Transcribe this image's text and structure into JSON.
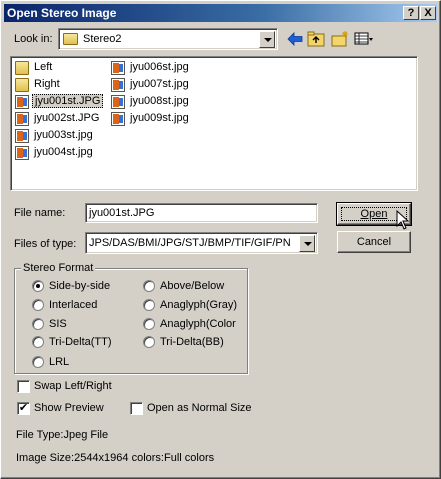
{
  "window": {
    "title": "Open Stereo Image"
  },
  "titlebar_buttons": {
    "help": "?",
    "close": "X"
  },
  "look_in": {
    "label": "Look in:",
    "value": "Stereo2"
  },
  "toolbar_icons": [
    "back-arrow-icon",
    "up-folder-icon",
    "new-folder-icon",
    "view-menu-icon"
  ],
  "files": [
    {
      "name": "Left",
      "type": "folder"
    },
    {
      "name": "Right",
      "type": "folder"
    },
    {
      "name": "jyu001st.JPG",
      "type": "jpg",
      "selected": true
    },
    {
      "name": "jyu002st.JPG",
      "type": "jpg"
    },
    {
      "name": "jyu003st.jpg",
      "type": "jpg"
    },
    {
      "name": "jyu004st.jpg",
      "type": "jpg"
    },
    {
      "name": "jyu006st.jpg",
      "type": "jpg"
    },
    {
      "name": "jyu007st.jpg",
      "type": "jpg"
    },
    {
      "name": "jyu008st.jpg",
      "type": "jpg"
    },
    {
      "name": "jyu009st.jpg",
      "type": "jpg"
    }
  ],
  "file_name": {
    "label": "File name:",
    "value": "jyu001st.JPG"
  },
  "file_type": {
    "label": "Files of type:",
    "value": "JPS/DAS/BMI/JPG/STJ/BMP/TIF/GIF/PN"
  },
  "buttons": {
    "open": "Open",
    "cancel": "Cancel"
  },
  "stereo_format": {
    "legend": "Stereo Format",
    "options": [
      {
        "label": "Side-by-side",
        "checked": true
      },
      {
        "label": "Interlaced"
      },
      {
        "label": "SIS"
      },
      {
        "label": "Tri-Delta(TT)"
      },
      {
        "label": "LRL"
      },
      {
        "label": "Above/Below"
      },
      {
        "label": "Anaglyph(Gray)"
      },
      {
        "label": "Anaglyph(Color"
      },
      {
        "label": "Tri-Delta(BB)"
      }
    ]
  },
  "options": {
    "swap": {
      "label": "Swap Left/Right",
      "checked": false
    },
    "preview": {
      "label": "Show Preview",
      "checked": true
    },
    "normal_size": {
      "label": "Open as Normal Size",
      "checked": false
    }
  },
  "info": {
    "file_type": "File Type:Jpeg File",
    "image_size": "Image Size:2544x1964  colors:Full colors"
  }
}
